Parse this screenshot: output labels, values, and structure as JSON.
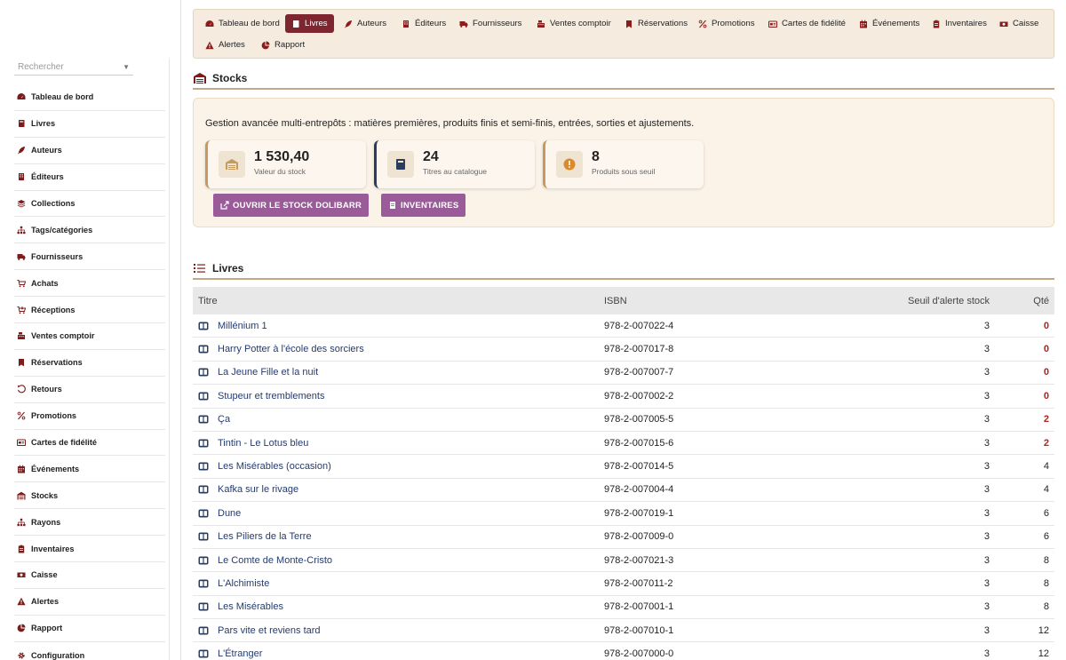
{
  "sidebar": {
    "search_placeholder": "Rechercher",
    "items": [
      {
        "label": "Tableau de bord",
        "icon": "gauge-icon"
      },
      {
        "label": "Livres",
        "icon": "book-icon"
      },
      {
        "label": "Auteurs",
        "icon": "feather-icon"
      },
      {
        "label": "Éditeurs",
        "icon": "building-icon"
      },
      {
        "label": "Collections",
        "icon": "layers-icon"
      },
      {
        "label": "Tags/catégories",
        "icon": "sitemap-icon"
      },
      {
        "label": "Fournisseurs",
        "icon": "truck-icon"
      },
      {
        "label": "Achats",
        "icon": "cart-icon"
      },
      {
        "label": "Réceptions",
        "icon": "cart-arrow-icon"
      },
      {
        "label": "Ventes comptoir",
        "icon": "cash-register-icon"
      },
      {
        "label": "Réservations",
        "icon": "bookmark-icon"
      },
      {
        "label": "Retours",
        "icon": "undo-icon"
      },
      {
        "label": "Promotions",
        "icon": "percent-icon"
      },
      {
        "label": "Cartes de fidélité",
        "icon": "card-icon"
      },
      {
        "label": "Événements",
        "icon": "calendar-icon"
      },
      {
        "label": "Stocks",
        "icon": "warehouse-icon"
      },
      {
        "label": "Rayons",
        "icon": "sitemap-icon"
      },
      {
        "label": "Inventaires",
        "icon": "clipboard-icon"
      },
      {
        "label": "Caisse",
        "icon": "money-icon"
      },
      {
        "label": "Alertes",
        "icon": "warning-icon"
      },
      {
        "label": "Rapport",
        "icon": "pie-chart-icon"
      },
      {
        "label": "Configuration",
        "icon": "gear-icon"
      }
    ]
  },
  "topnav": {
    "tabs": [
      {
        "label": "Tableau de bord",
        "icon": "gauge-icon",
        "active": false
      },
      {
        "label": "Livres",
        "icon": "book-icon",
        "active": true
      },
      {
        "label": "Auteurs",
        "icon": "feather-icon",
        "active": false
      },
      {
        "label": "Éditeurs",
        "icon": "building-icon",
        "active": false
      },
      {
        "label": "Fournisseurs",
        "icon": "truck-icon",
        "active": false
      },
      {
        "label": "Ventes comptoir",
        "icon": "cash-register-icon",
        "active": false
      },
      {
        "label": "Réservations",
        "icon": "bookmark-icon",
        "active": false
      },
      {
        "label": "Promotions",
        "icon": "percent-icon",
        "active": false
      },
      {
        "label": "Cartes de fidélité",
        "icon": "card-icon",
        "active": false
      },
      {
        "label": "Événements",
        "icon": "calendar-icon",
        "active": false
      },
      {
        "label": "Inventaires",
        "icon": "clipboard-icon",
        "active": false
      },
      {
        "label": "Caisse",
        "icon": "money-icon",
        "active": false
      },
      {
        "label": "Alertes",
        "icon": "warning-icon",
        "active": false
      },
      {
        "label": "Rapport",
        "icon": "pie-chart-icon",
        "active": false
      }
    ]
  },
  "stocks": {
    "title": "Stocks",
    "description": "Gestion avancée multi-entrepôts : matières premières, produits finis et semi-finis, entrées, sorties et ajustements.",
    "kpis": [
      {
        "value": "1 530,40",
        "label": "Valeur du stock",
        "icon": "warehouse-icon"
      },
      {
        "value": "24",
        "label": "Titres au catalogue",
        "icon": "book-icon"
      },
      {
        "value": "8",
        "label": "Produits sous seuil",
        "icon": "alert-circle-icon"
      }
    ],
    "buttons": {
      "open_stock": "OUVRIR LE STOCK DOLIBARR",
      "inventories": "INVENTAIRES"
    }
  },
  "books": {
    "title": "Livres",
    "columns": {
      "title": "Titre",
      "isbn": "ISBN",
      "threshold": "Seuil d'alerte stock",
      "qty": "Qté"
    },
    "rows": [
      {
        "title": "Millénium 1",
        "isbn": "978-2-007022-4",
        "threshold": "3",
        "qty": "0"
      },
      {
        "title": "Harry Potter à l'école des sorciers",
        "isbn": "978-2-007017-8",
        "threshold": "3",
        "qty": "0"
      },
      {
        "title": "La Jeune Fille et la nuit",
        "isbn": "978-2-007007-7",
        "threshold": "3",
        "qty": "0"
      },
      {
        "title": "Stupeur et tremblements",
        "isbn": "978-2-007002-2",
        "threshold": "3",
        "qty": "0"
      },
      {
        "title": "Ça",
        "isbn": "978-2-007005-5",
        "threshold": "3",
        "qty": "2"
      },
      {
        "title": "Tintin - Le Lotus bleu",
        "isbn": "978-2-007015-6",
        "threshold": "3",
        "qty": "2"
      },
      {
        "title": "Les Misérables (occasion)",
        "isbn": "978-2-007014-5",
        "threshold": "3",
        "qty": "4"
      },
      {
        "title": "Kafka sur le rivage",
        "isbn": "978-2-007004-4",
        "threshold": "3",
        "qty": "4"
      },
      {
        "title": "Dune",
        "isbn": "978-2-007019-1",
        "threshold": "3",
        "qty": "6"
      },
      {
        "title": "Les Piliers de la Terre",
        "isbn": "978-2-007009-0",
        "threshold": "3",
        "qty": "6"
      },
      {
        "title": "Le Comte de Monte-Cristo",
        "isbn": "978-2-007021-3",
        "threshold": "3",
        "qty": "8"
      },
      {
        "title": "L'Alchimiste",
        "isbn": "978-2-007011-2",
        "threshold": "3",
        "qty": "8"
      },
      {
        "title": "Les Misérables",
        "isbn": "978-2-007001-1",
        "threshold": "3",
        "qty": "8"
      },
      {
        "title": "Pars vite et reviens tard",
        "isbn": "978-2-007010-1",
        "threshold": "3",
        "qty": "12"
      },
      {
        "title": "L'Étranger",
        "isbn": "978-2-007000-0",
        "threshold": "3",
        "qty": "12"
      }
    ]
  },
  "colors": {
    "accent": "#7e2630",
    "nav_bg": "#f5ecdf",
    "button": "#9a5c98",
    "link": "#253b6e",
    "alert_qty": "#b3221d"
  }
}
